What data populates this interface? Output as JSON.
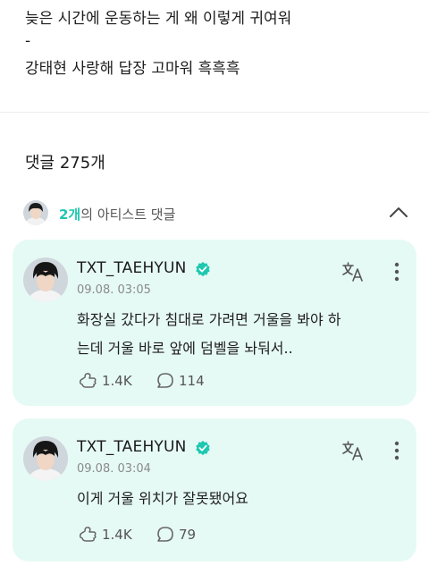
{
  "post": {
    "line1": "늦은 시간에 운동하는 게 왜 이렇게 귀여워",
    "line2": "-",
    "line3": "강태현 사랑해 답장 고마워 흑흑흑"
  },
  "comments": {
    "title": "댓글 275개",
    "artist_count": "2개",
    "artist_label": "의 아티스트 댓글"
  },
  "cards": [
    {
      "name": "TXT_TAEHYUN",
      "time": "09.08. 03:05",
      "line1": "화장실 갔다가 침대로 가려면 거울을 봐야 하",
      "line2": "는데 거울 바로 앞에 덤벨을 놔둬서..",
      "likes": "1.4K",
      "replies": "114"
    },
    {
      "name": "TXT_TAEHYUN",
      "time": "09.08. 03:04",
      "line1": "이게 거울 위치가 잘못됐어요",
      "likes": "1.4K",
      "replies": "79"
    }
  ],
  "colors": {
    "accent": "#1ec8b0",
    "card_bg": "#e6faf5",
    "verified": "#1ec8b0"
  }
}
